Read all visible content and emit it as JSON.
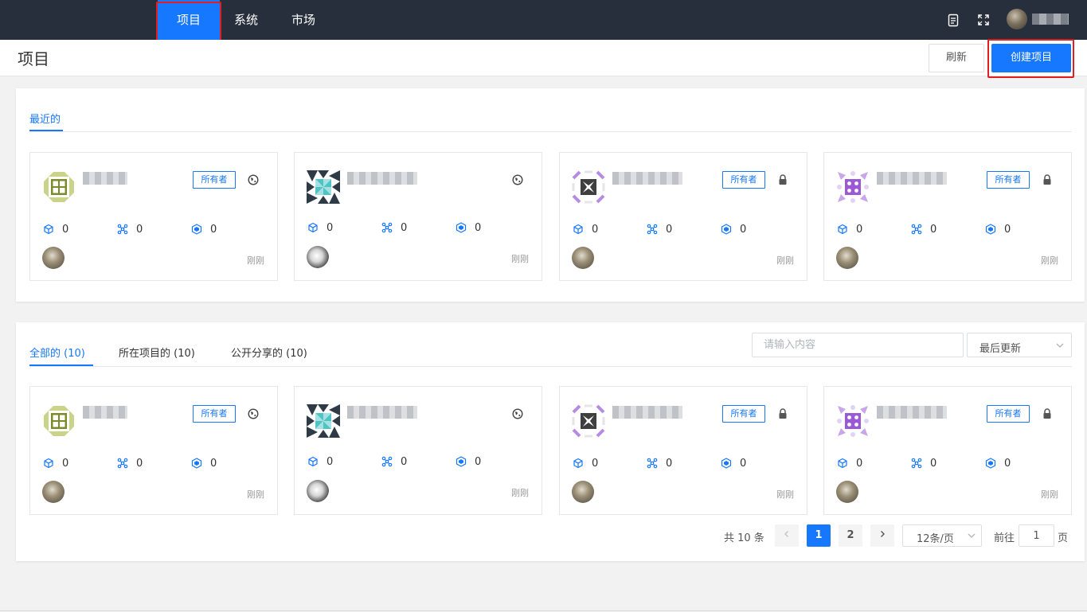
{
  "nav": {
    "items": [
      {
        "label": "项目",
        "active": true
      },
      {
        "label": "系统",
        "active": false
      },
      {
        "label": "市场",
        "active": false
      }
    ],
    "icons": [
      "document-icon",
      "fullscreen-icon"
    ]
  },
  "header": {
    "title": "项目",
    "refresh_label": "刷新",
    "create_label": "创建项目"
  },
  "recent": {
    "tab_label": "最近的"
  },
  "all": {
    "tabs": [
      {
        "label": "全部的 (10)",
        "active": true
      },
      {
        "label": "所在项目的 (10)",
        "active": false
      },
      {
        "label": "公开分享的 (10)",
        "active": false
      }
    ],
    "search_placeholder": "请输入内容",
    "sort_value": "最后更新"
  },
  "cards": [
    {
      "owner_tag": "所有者",
      "visibility": "public",
      "stats": [
        "0",
        "0",
        "0"
      ],
      "time": "刚刚",
      "logo": "green-grid"
    },
    {
      "owner_tag": "",
      "visibility": "public",
      "stats": [
        "0",
        "0",
        "0"
      ],
      "time": "刚刚",
      "logo": "teal-pinwheel"
    },
    {
      "owner_tag": "所有者",
      "visibility": "private",
      "stats": [
        "0",
        "0",
        "0"
      ],
      "time": "刚刚",
      "logo": "purple-x"
    },
    {
      "owner_tag": "所有者",
      "visibility": "private",
      "stats": [
        "0",
        "0",
        "0"
      ],
      "time": "刚刚",
      "logo": "purple-dots"
    }
  ],
  "pagination": {
    "total_text": "共 10 条",
    "pages": [
      "1",
      "2"
    ],
    "current_page": "1",
    "page_size": "12条/页",
    "goto_label": "前往",
    "goto_value": "1",
    "page_unit": "页"
  },
  "colors": {
    "primary": "#1677ff",
    "nav_bg": "#282f3c",
    "highlight": "#e02020"
  }
}
